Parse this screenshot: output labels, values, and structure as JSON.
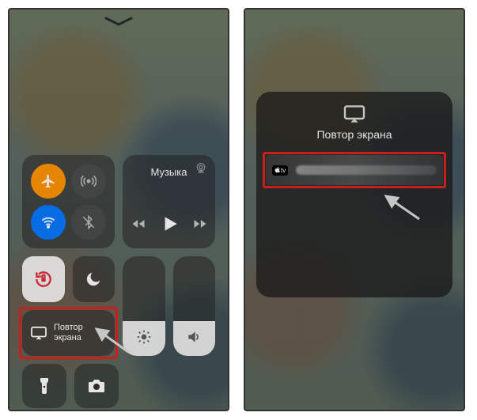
{
  "left": {
    "music_label": "Музыка",
    "mirror_label": "Повтор\nэкрана",
    "icons": {
      "airplane": "airplane-icon",
      "cellular": "cellular-antenna-icon",
      "wifi": "wifi-icon",
      "bluetooth": "bluetooth-icon",
      "lock_rotation": "rotation-lock-icon",
      "dnd": "moon-icon",
      "screen_mirror": "screen-mirror-icon",
      "brightness": "sun-icon",
      "volume": "speaker-icon",
      "flashlight": "flashlight-icon",
      "camera": "camera-icon",
      "prev": "previous-track-icon",
      "play": "play-icon",
      "next": "next-track-icon",
      "airplay_audio": "airplay-audio-icon"
    }
  },
  "right": {
    "panel_title": "Повтор экрана",
    "device_badge": "tv",
    "icons": {
      "screen_mirror": "screen-mirror-icon",
      "apple": "apple-logo-icon"
    }
  },
  "colors": {
    "highlight": "#e2221f",
    "airplane": "#ff9500",
    "wifi": "#0a7aff"
  }
}
